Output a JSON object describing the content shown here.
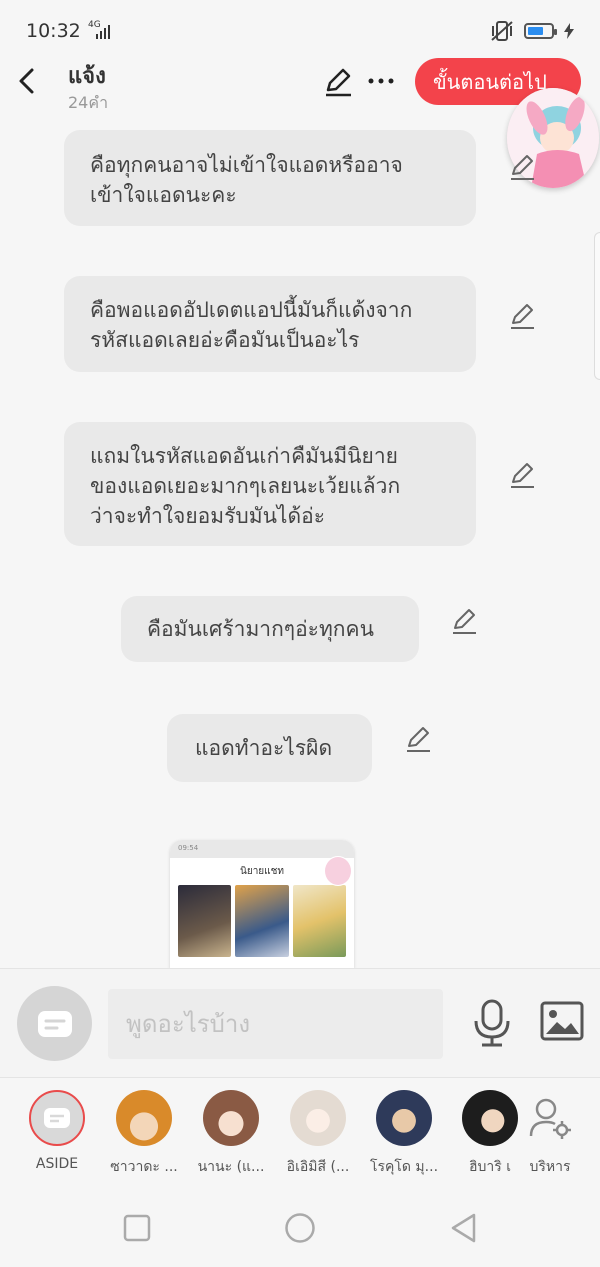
{
  "status": {
    "time": "10:32",
    "network": "4G"
  },
  "header": {
    "title": "แจ้ง",
    "subtitle": "24คำ",
    "next_button": "ขั้นตอนต่อไป"
  },
  "messages": [
    {
      "lines": [
        "คือทุกคนอาจไม่เข้าใจแอดหรืออาจ",
        "เข้าใจแอดนะคะ"
      ]
    },
    {
      "lines": [
        "คือพอแอดอัปเดตแอปนี้มันก็แด้งจาก",
        "รหัสแอดเลยอ่ะคือมันเป็นอะไร"
      ]
    },
    {
      "lines": [
        "แถมในรหัสแอดอันเก่าคืมันมีนิยาย",
        "ของแอดเยอะมากๆเลยนะเว้ยแล้วก",
        "ว่าจะทำใจยอมรับมันได้อ่ะ"
      ]
    },
    {
      "lines": [
        "คือมันเศร้ามากๆอ่ะทุกคน"
      ]
    },
    {
      "lines": [
        "แอดทำอะไรผิด"
      ]
    }
  ],
  "thumbnail": {
    "status_time": "09:54",
    "title": "นิยายแชท"
  },
  "composer": {
    "placeholder": "พูดอะไรบ้าง"
  },
  "characters": [
    {
      "name": "ASIDE",
      "color": "#e94b4b"
    },
    {
      "name": "ซาวาดะ ...",
      "color": "#d9932d"
    },
    {
      "name": "นานะ (แ...",
      "color": "#8a5a44"
    },
    {
      "name": "อิเอิมิสี (...",
      "color": "#d8cfc8"
    },
    {
      "name": "โรคุโด มุ...",
      "color": "#2e3a5a"
    },
    {
      "name": "ฮิบาริ เ",
      "color": "#1d1d1d"
    },
    {
      "name": "บริหาร",
      "color": "#888888"
    }
  ],
  "colors": {
    "accent": "#f3434b",
    "bubble": "#e9e9e9",
    "battery": "#2a8df0"
  }
}
